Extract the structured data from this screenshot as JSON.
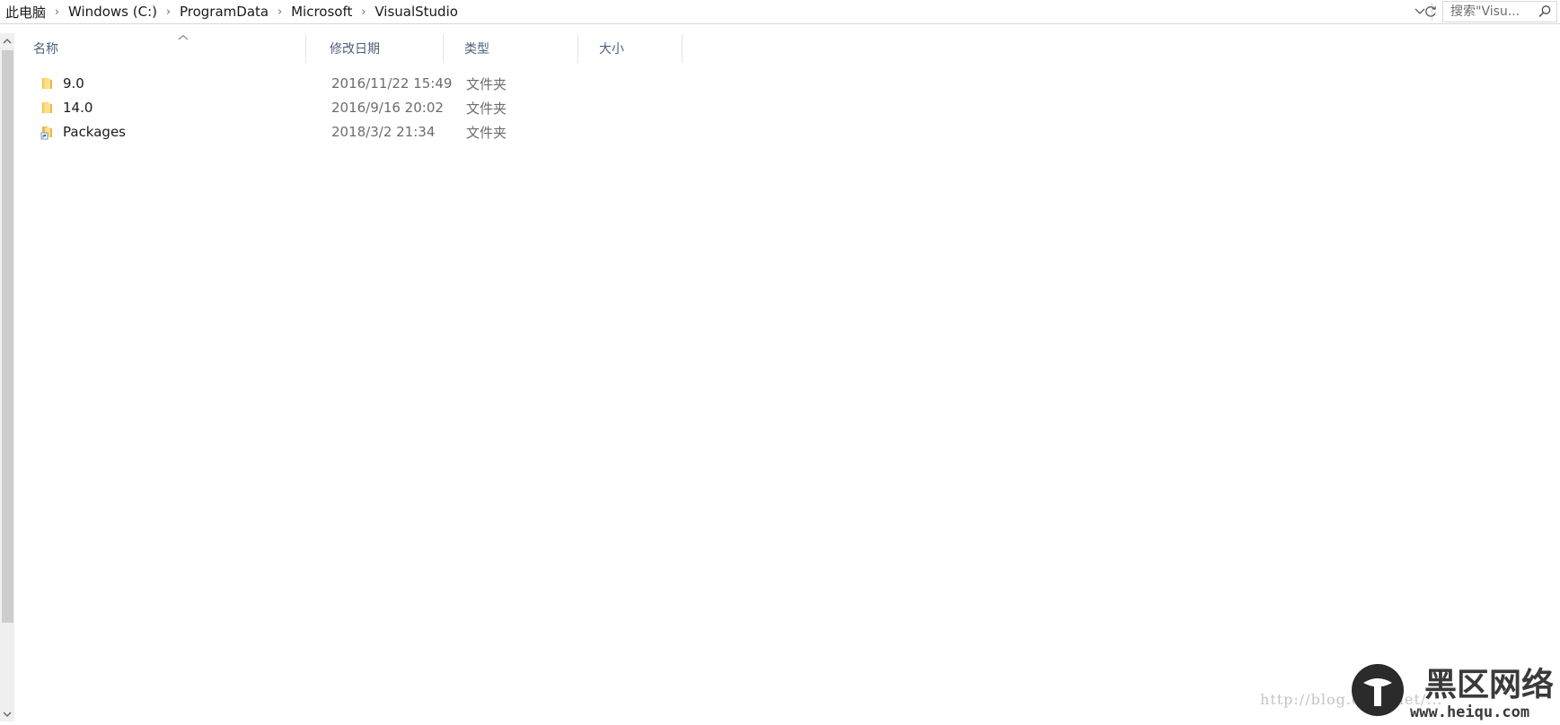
{
  "address_bar": {
    "breadcrumbs": [
      "此电脑",
      "Windows (C:)",
      "ProgramData",
      "Microsoft",
      "VisualStudio"
    ],
    "search_placeholder": "搜索\"Visu..."
  },
  "columns": {
    "name": "名称",
    "date": "修改日期",
    "type": "类型",
    "size": "大小"
  },
  "files": [
    {
      "name": "9.0",
      "date": "2016/11/22 15:49",
      "type": "文件夹",
      "icon": "folder-icon"
    },
    {
      "name": "14.0",
      "date": "2016/9/16 20:02",
      "type": "文件夹",
      "icon": "folder-icon"
    },
    {
      "name": "Packages",
      "date": "2018/3/2 21:34",
      "type": "文件夹",
      "icon": "folder-shortcut-icon"
    }
  ],
  "watermark": {
    "url": "http://blog.csdn.net/...",
    "logo_text": "黑区网络",
    "logo_site": "www.heiqu.com"
  },
  "colors": {
    "header_text": "#4c607a",
    "folder": "#ffd766",
    "logo_circle": "#2b2b2b"
  }
}
